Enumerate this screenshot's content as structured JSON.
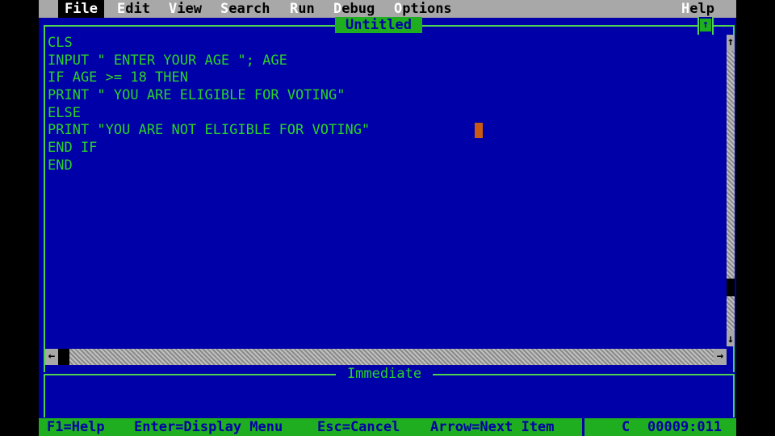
{
  "menu": [
    {
      "hotkey": "F",
      "rest": "ile",
      "active": true
    },
    {
      "hotkey": "E",
      "rest": "dit"
    },
    {
      "hotkey": "V",
      "rest": "iew"
    },
    {
      "hotkey": "S",
      "rest": "earch"
    },
    {
      "hotkey": "R",
      "rest": "un"
    },
    {
      "hotkey": "D",
      "rest": "ebug"
    },
    {
      "hotkey": "O",
      "rest": "ptions"
    },
    {
      "hotkey": "H",
      "rest": "elp"
    }
  ],
  "editor": {
    "title": "Untitled",
    "lines": [
      "CLS",
      "INPUT \" ENTER YOUR AGE \"; AGE",
      "IF AGE >= 18 THEN",
      "PRINT \" YOU ARE ELIGIBLE FOR VOTING\"",
      "ELSE",
      "PRINT \"YOU ARE NOT ELIGIBLE FOR VOTING\"",
      "END IF",
      "END"
    ],
    "maximize_glyph": "↑",
    "scroll_up_glyph": "↑",
    "scroll_down_glyph": "↓",
    "scroll_left_glyph": "←",
    "scroll_right_glyph": "→"
  },
  "immediate": {
    "title": "Immediate"
  },
  "status": {
    "hints": [
      "F1=Help",
      "Enter=Display Menu",
      "Esc=Cancel",
      "Arrow=Next Item"
    ],
    "caps": "C",
    "position": "00009:011"
  },
  "colors": {
    "background": "#0000a8",
    "text": "#2ad22a",
    "menubar": "#a8a8a8",
    "statusbar": "#1fae1f",
    "cursor": "#c85a14"
  }
}
